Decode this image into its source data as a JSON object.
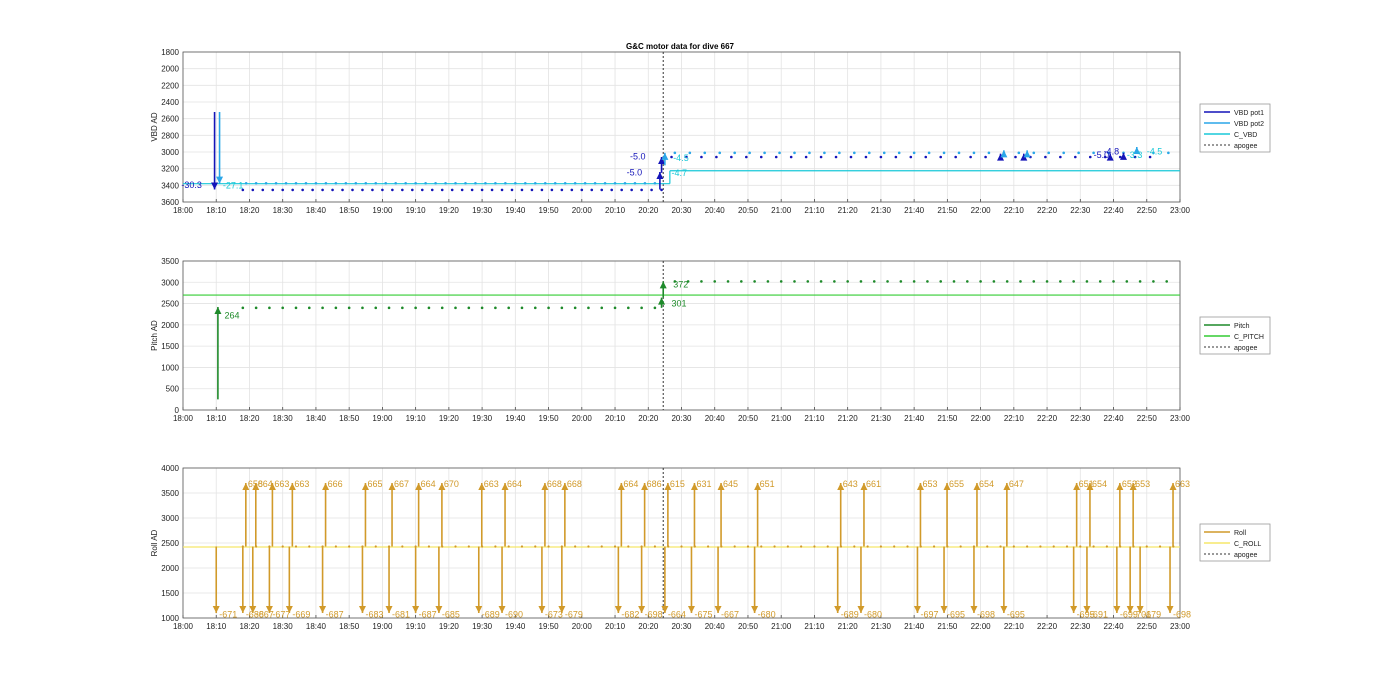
{
  "figure": {
    "title": "G&C motor data for dive 667"
  },
  "chart_data": [
    {
      "type": "line",
      "title": "G&C motor data for dive 667",
      "ylabel": "VBD AD",
      "y_reversed": true,
      "ylim": [
        1800,
        3600
      ],
      "yticks": [
        1800,
        2000,
        2200,
        2400,
        2600,
        2800,
        3000,
        3200,
        3400,
        3600
      ],
      "xlim_min": [
        0,
        300
      ],
      "xticks": [
        "18:00",
        "18:10",
        "18:20",
        "18:30",
        "18:40",
        "18:50",
        "19:00",
        "19:10",
        "19:20",
        "19:30",
        "19:40",
        "19:50",
        "20:00",
        "20:10",
        "20:20",
        "20:30",
        "20:40",
        "20:50",
        "21:00",
        "21:10",
        "21:20",
        "21:30",
        "21:40",
        "21:50",
        "22:00",
        "22:10",
        "22:20",
        "22:30",
        "22:40",
        "22:50",
        "23:00"
      ],
      "grid": true,
      "legend": [
        "VBD pot1",
        "VBD pot2",
        "C_VBD",
        "apogee"
      ],
      "legend_position": "outside-right",
      "colors": {
        "pot1": "#1414b8",
        "pot2": "#2aa6e8",
        "cvbd": "#18c8d8",
        "apogee": "#333333"
      },
      "c_vbd": [
        {
          "x": [
            0,
            146.5
          ],
          "y": 3380
        },
        {
          "x": [
            146.5,
            300
          ],
          "y": 3225
        }
      ],
      "apogee_x": 144.5,
      "series": [
        {
          "name": "VBD pot1",
          "x_start": 18,
          "x_end": 145,
          "x_step": 3,
          "y": 3455
        },
        {
          "name": "VBD pot1",
          "x_start": 147,
          "x_end": 295,
          "x_step": 4.5,
          "y": 3060
        },
        {
          "name": "VBD pot2",
          "x_start": 19,
          "x_end": 143,
          "x_step": 3,
          "y": 3375
        },
        {
          "name": "VBD pot2",
          "x_start": 148,
          "x_end": 298,
          "x_step": 4.5,
          "y": 3010
        }
      ],
      "arrows": [
        {
          "x": 9.5,
          "y_from": 2520,
          "y_to": 3450,
          "series": "pot1"
        },
        {
          "x": 11,
          "y_from": 2520,
          "y_to": 3380,
          "series": "pot2"
        },
        {
          "x": 143.5,
          "y_from": 3450,
          "y_to": 3240,
          "series": "pot1"
        },
        {
          "x": 144,
          "y_from": 3250,
          "y_to": 3060,
          "series": "pot1"
        },
        {
          "x": 145,
          "y_from": 3160,
          "y_to": 3010,
          "series": "pot2"
        },
        {
          "x": 246,
          "y_from": 3060,
          "y_to": 3020,
          "series": "pot1"
        },
        {
          "x": 253,
          "y_from": 3060,
          "y_to": 3020,
          "series": "pot1"
        },
        {
          "x": 283,
          "y_from": 3060,
          "y_to": 3010,
          "series": "pot1"
        },
        {
          "x": 247,
          "y_from": 3010,
          "y_to": 2980,
          "series": "pot2"
        },
        {
          "x": 254,
          "y_from": 3010,
          "y_to": 2980,
          "series": "pot2"
        },
        {
          "x": 287,
          "y_from": 3010,
          "y_to": 2940,
          "series": "pot2"
        },
        {
          "x": 279,
          "y_from": 3060,
          "y_to": 3020,
          "series": "pot1"
        }
      ],
      "labels": [
        {
          "x": -0.5,
          "y": 3430,
          "text": "-30.3",
          "series": "pot1"
        },
        {
          "x": 12,
          "y": 3440,
          "text": "-27.1",
          "series": "pot2"
        },
        {
          "x": 134.5,
          "y": 3090,
          "text": "-5.0",
          "series": "pot1"
        },
        {
          "x": 133.5,
          "y": 3280,
          "text": "-5.0",
          "series": "pot1"
        },
        {
          "x": 147.5,
          "y": 3110,
          "text": "-4.5",
          "series": "pot2"
        },
        {
          "x": 147,
          "y": 3290,
          "text": "-4.7",
          "series": "pot2"
        },
        {
          "x": 277,
          "y": 3030,
          "text": "-4.8",
          "series": "pot1"
        },
        {
          "x": 274,
          "y": 3070,
          "text": "-5.0",
          "series": "pot1"
        },
        {
          "x": 284,
          "y": 3070,
          "text": "-3.3",
          "series": "pot2"
        },
        {
          "x": 290,
          "y": 3030,
          "text": "-4.5",
          "series": "pot2"
        }
      ]
    },
    {
      "type": "line",
      "ylabel": "Pitch AD",
      "ylim": [
        0,
        3500
      ],
      "yticks": [
        0,
        500,
        1000,
        1500,
        2000,
        2500,
        3000,
        3500
      ],
      "grid": true,
      "legend": [
        "Pitch",
        "C_PITCH",
        "apogee"
      ],
      "legend_position": "outside-right",
      "colors": {
        "pitch": "#1e8a2a",
        "c_pitch": "#33cc33",
        "apogee": "#333333"
      },
      "c_pitch": 2700,
      "apogee_x": 144.5,
      "series": [
        {
          "name": "Pitch",
          "x_start": 18,
          "x_end": 143,
          "x_step": 4,
          "y": 2400
        },
        {
          "name": "Pitch",
          "x_start": 148,
          "x_end": 297,
          "x_step": 4,
          "y": 3020
        }
      ],
      "arrows": [
        {
          "x": 10.5,
          "y_from": 250,
          "y_to": 2420
        },
        {
          "x": 144,
          "y_from": 2400,
          "y_to": 2640
        },
        {
          "x": 144.5,
          "y_from": 2640,
          "y_to": 3020
        }
      ],
      "labels": [
        {
          "x": 12.5,
          "y": 2150,
          "text": "264"
        },
        {
          "x": 147.5,
          "y": 2880,
          "text": "372"
        },
        {
          "x": 147,
          "y": 2430,
          "text": "301"
        }
      ]
    },
    {
      "type": "line",
      "ylabel": "Roll AD",
      "ylim": [
        1000,
        4000
      ],
      "yticks": [
        1000,
        1500,
        2000,
        2500,
        3000,
        3500,
        4000
      ],
      "grid": true,
      "legend": [
        "Roll",
        "C_ROLL",
        "apogee"
      ],
      "legend_position": "outside-right",
      "colors": {
        "roll": "#d19a2a",
        "c_roll": "#f5e76a",
        "apogee": "#333333"
      },
      "c_roll": 2420,
      "apogee_x": 144.5,
      "roll_dots": {
        "x_start": 18,
        "x_end": 300,
        "x_step": 4,
        "y": 2430
      },
      "events": [
        {
          "x": 10,
          "bottom": "-671",
          "top": null
        },
        {
          "x": 18,
          "bottom": "-688",
          "top": "658"
        },
        {
          "x": 21,
          "bottom": "-667",
          "top": "664"
        },
        {
          "x": 26,
          "bottom": "-677",
          "top": "663"
        },
        {
          "x": 32,
          "bottom": "-669",
          "top": "663"
        },
        {
          "x": 42,
          "bottom": "-687",
          "top": "666"
        },
        {
          "x": 54,
          "bottom": "-683",
          "top": "665"
        },
        {
          "x": 62,
          "bottom": "-681",
          "top": "667"
        },
        {
          "x": 70,
          "bottom": "-687",
          "top": "664"
        },
        {
          "x": 77,
          "bottom": "-685",
          "top": "670"
        },
        {
          "x": 89,
          "bottom": "-689",
          "top": "663"
        },
        {
          "x": 96,
          "bottom": "-690",
          "top": "664"
        },
        {
          "x": 108,
          "bottom": "-673",
          "top": "668"
        },
        {
          "x": 114,
          "bottom": "-679",
          "top": "668"
        },
        {
          "x": 131,
          "bottom": "-682",
          "top": "664"
        },
        {
          "x": 138,
          "bottom": "-698",
          "top": "686"
        },
        {
          "x": 145,
          "bottom": "-664",
          "top": "615"
        },
        {
          "x": 153,
          "bottom": "-675",
          "top": "631"
        },
        {
          "x": 161,
          "bottom": "-667",
          "top": "645"
        },
        {
          "x": 172,
          "bottom": "-680",
          "top": "651"
        },
        {
          "x": 197,
          "bottom": "-689",
          "top": "643"
        },
        {
          "x": 204,
          "bottom": "-680",
          "top": "661"
        },
        {
          "x": 221,
          "bottom": "-697",
          "top": "653"
        },
        {
          "x": 229,
          "bottom": "-695",
          "top": "655"
        },
        {
          "x": 238,
          "bottom": "-698",
          "top": "654"
        },
        {
          "x": 247,
          "bottom": "-695",
          "top": "647"
        },
        {
          "x": 268,
          "bottom": "-695",
          "top": "651"
        },
        {
          "x": 272,
          "bottom": "-691",
          "top": "654"
        },
        {
          "x": 281,
          "bottom": "-699",
          "top": "652"
        },
        {
          "x": 285,
          "bottom": "-701",
          "top": "653"
        },
        {
          "x": 288,
          "bottom": "-679",
          "top": null
        },
        {
          "x": 297,
          "bottom": "-698",
          "top": "663"
        }
      ]
    }
  ]
}
